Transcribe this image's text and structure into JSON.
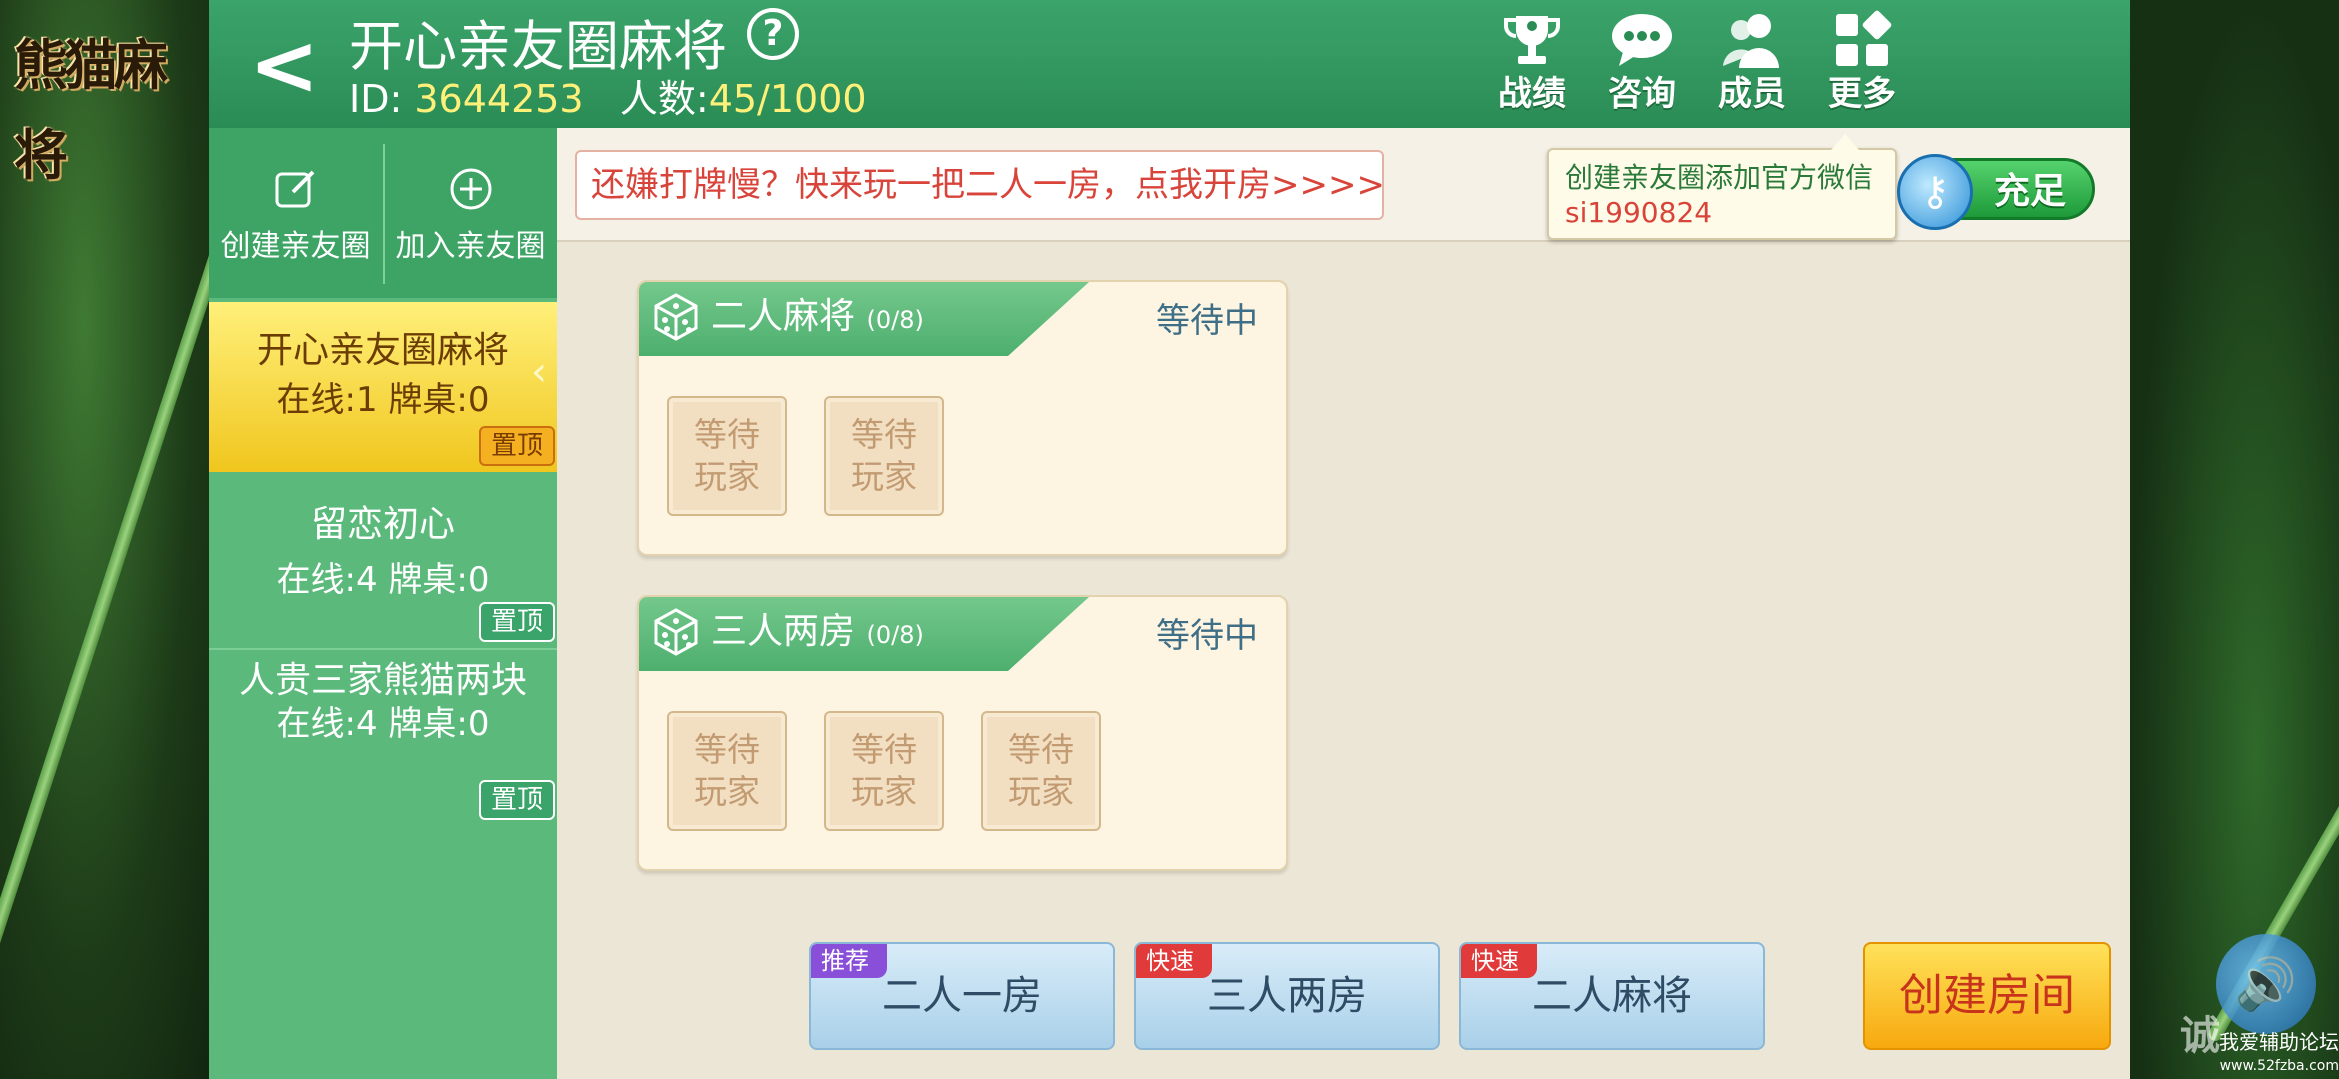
{
  "app": {
    "logo_text": "熊猫麻将"
  },
  "header": {
    "back_symbol": "<",
    "title": "开心亲友圈麻将",
    "help_symbol": "?",
    "id_label": "ID:",
    "id_value": "3644253",
    "count_label": "人数:",
    "count_value": "45/1000",
    "actions": [
      {
        "label": "战绩",
        "icon": "trophy-icon"
      },
      {
        "label": "咨询",
        "icon": "chat-icon"
      },
      {
        "label": "成员",
        "icon": "members-icon"
      },
      {
        "label": "更多",
        "icon": "more-icon"
      }
    ]
  },
  "sidebar": {
    "create_label": "创建亲友圈",
    "join_label": "加入亲友圈",
    "clubs": [
      {
        "name": "开心亲友圈麻将",
        "status": "在线:1 牌桌:0",
        "pin": "置顶",
        "active": true
      },
      {
        "name": "留恋初心",
        "status": "在线:4 牌桌:0",
        "pin": "置顶",
        "active": false
      },
      {
        "name": "人贵三家熊猫两块",
        "status": "在线:4 牌桌:0",
        "pin": "置顶",
        "active": false
      }
    ]
  },
  "marquee": {
    "text": "还嫌打牌慢？快来玩一把二人一房，点我开房>>>>"
  },
  "tip": {
    "line1": "创建亲友圈添加官方微信",
    "line2": "si1990824"
  },
  "recharge": {
    "label": "充足"
  },
  "rooms": [
    {
      "name": "二人麻将",
      "count": "(0/8)",
      "status": "等待中",
      "seats": [
        "等待\n玩家",
        "等待\n玩家"
      ]
    },
    {
      "name": "三人两房",
      "count": "(0/8)",
      "status": "等待中",
      "seats": [
        "等待\n玩家",
        "等待\n玩家",
        "等待\n玩家"
      ]
    }
  ],
  "seat_line1": "等待",
  "seat_line2": "玩家",
  "quick_buttons": [
    {
      "badge": "推荐",
      "label": "二人一房"
    },
    {
      "badge": "快速",
      "label": "三人两房"
    },
    {
      "badge": "快速",
      "label": "二人麻将"
    }
  ],
  "create_room": {
    "label": "创建房间"
  },
  "watermark": {
    "big": "诚",
    "line1": "我爱辅助论坛",
    "line2": "www.52fzba.com"
  },
  "colors": {
    "header_green": "#2a8c55",
    "accent_yellow": "#f0c61e",
    "alert_red": "#d8443a"
  }
}
